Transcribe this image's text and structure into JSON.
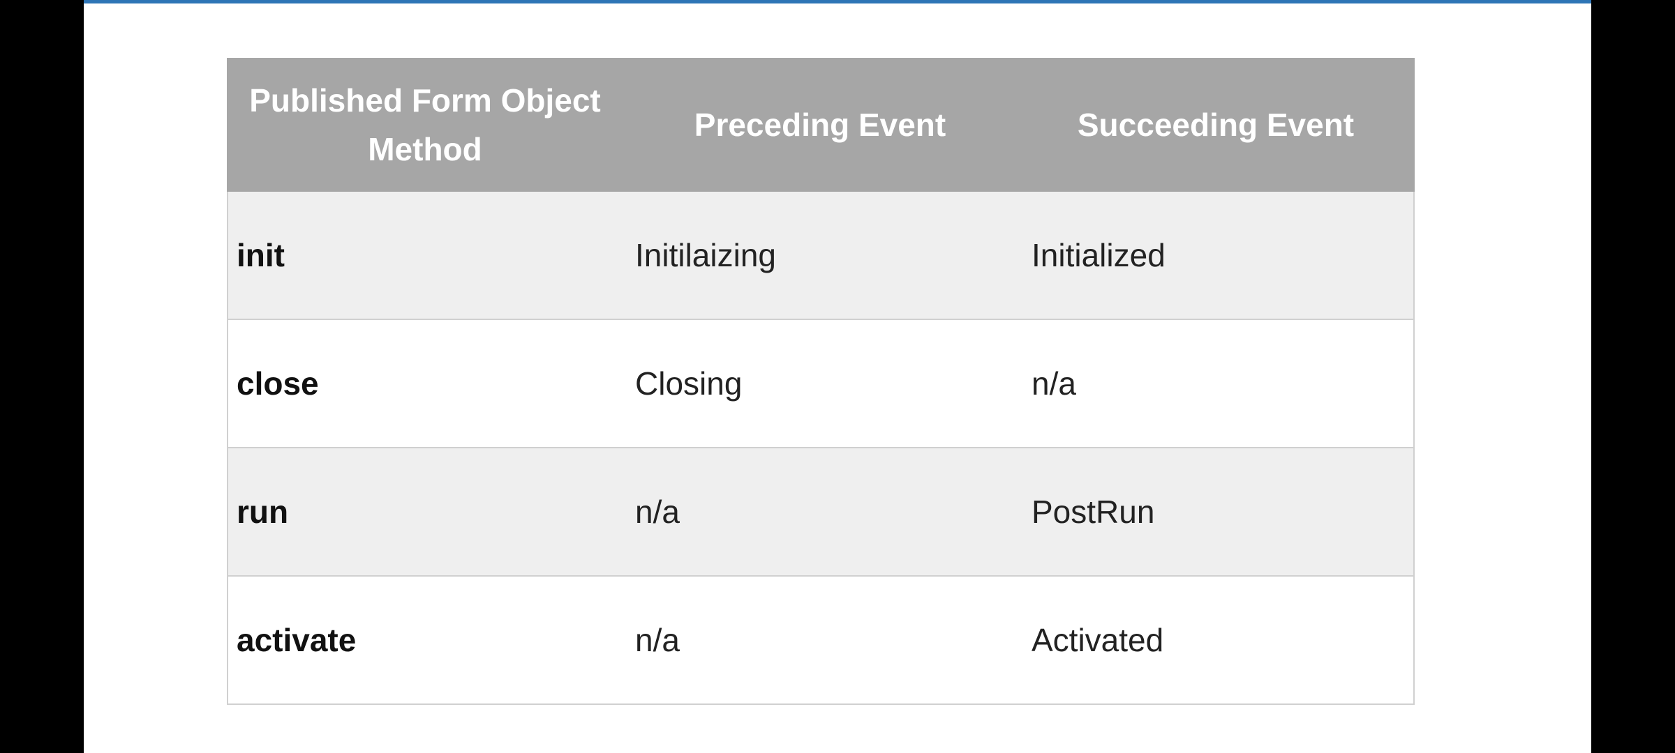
{
  "colors": {
    "header_bg": "#a6a6a6",
    "header_text": "#ffffff",
    "row_shaded": "#efefef",
    "row_plain": "#ffffff",
    "accent_bar": "#2e75b6"
  },
  "table": {
    "headers": [
      "Published Form Object Method",
      "Preceding Event",
      "Succeeding Event"
    ],
    "rows": [
      {
        "method": "init",
        "preceding": "Initilaizing",
        "succeeding": "Initialized"
      },
      {
        "method": "close",
        "preceding": "Closing",
        "succeeding": "n/a"
      },
      {
        "method": "run",
        "preceding": "n/a",
        "succeeding": "PostRun"
      },
      {
        "method": "activate",
        "preceding": "n/a",
        "succeeding": "Activated"
      }
    ]
  }
}
